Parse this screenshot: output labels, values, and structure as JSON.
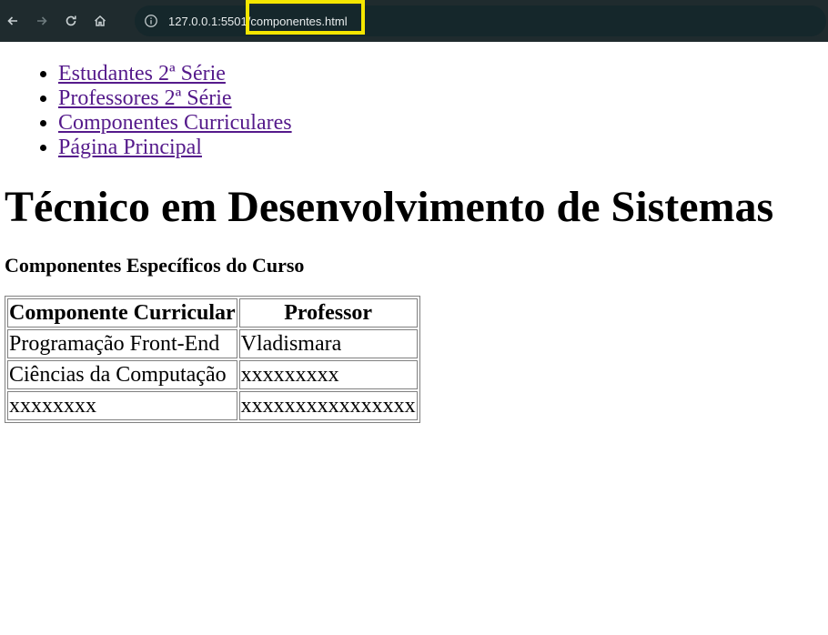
{
  "browser": {
    "url_host": "127.0.0.1:5501",
    "url_path": "/componentes.html"
  },
  "nav": {
    "items": [
      "Estudantes 2ª Série",
      "Professores 2ª Série",
      "Componentes Curriculares",
      "Página Principal"
    ]
  },
  "page": {
    "title": "Técnico em Desenvolvimento de Sistemas",
    "subtitle": "Componentes Específicos do Curso"
  },
  "table": {
    "headers": [
      "Componente Curricular",
      "Professor"
    ],
    "rows": [
      [
        "Programação Front-End",
        "Vladismara"
      ],
      [
        "Ciências da Computação",
        "xxxxxxxxx"
      ],
      [
        "xxxxxxxx",
        "xxxxxxxxxxxxxxxx"
      ]
    ]
  },
  "colors": {
    "link": "#551a8b",
    "highlight": "#f5e600",
    "toolbar": "#1f2b2e"
  }
}
